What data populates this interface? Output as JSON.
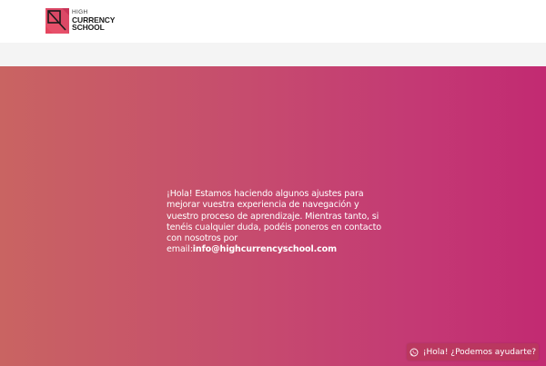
{
  "header": {
    "logo": {
      "line1": "HIGH",
      "line2": "CURRENCY",
      "line3": "SCHOOL",
      "icon": "high-currency-school-logo-icon",
      "colors": {
        "pink": "#e5465f",
        "darkpink": "#b8284f",
        "light": "#f0607a"
      }
    }
  },
  "hero": {
    "message": "¡Hola! Estamos haciendo algunos ajustes para mejorar vuestra experiencia de navegación y vuestro proceso de aprendizaje. Mientras tanto, si tenéis cualquier duda, podéis poneros en contacto con nosotros por email:",
    "email": "info@highcurrencyschool.com",
    "gradient": {
      "from": "#c96462",
      "to": "#c22a72"
    }
  },
  "chat": {
    "label": "¡Hola! ¿Podemos ayudarte?",
    "icon": "whatsapp-icon"
  }
}
